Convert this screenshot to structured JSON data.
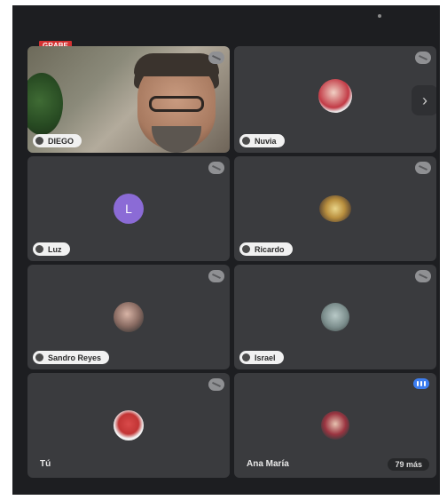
{
  "recording": {
    "label": "GRABE"
  },
  "participants": [
    {
      "name": "DIEGO",
      "has_video": true
    },
    {
      "name": "Nuvia"
    },
    {
      "name": "Luz",
      "initial": "L",
      "avatar_color": "#8b6bd6"
    },
    {
      "name": "Ricardo"
    },
    {
      "name": "Sandro Reyes"
    },
    {
      "name": "Israel"
    },
    {
      "name": "Tú"
    },
    {
      "name": "Ana María",
      "speaking": true
    }
  ],
  "more": {
    "label": "79 más"
  },
  "icons": {
    "mic_off": "mic-off-icon",
    "next": "chevron-right-icon",
    "speaking": "audio-bars-icon"
  }
}
